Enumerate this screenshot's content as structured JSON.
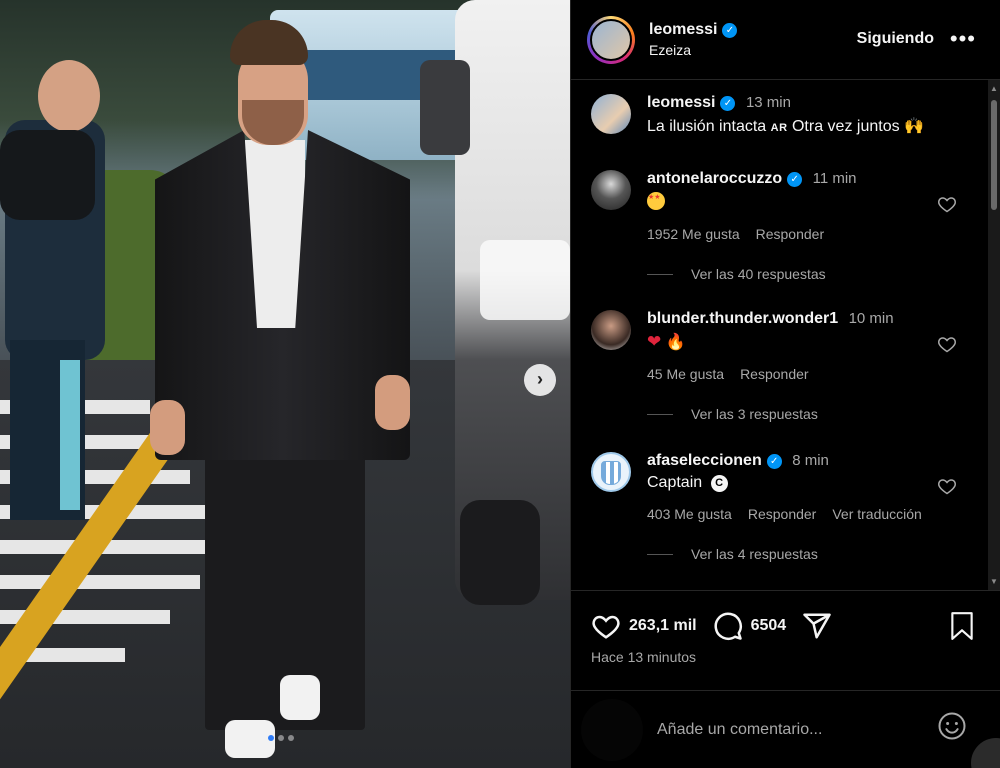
{
  "post": {
    "username": "leomessi",
    "location": "Ezeiza",
    "follow_label": "Siguiendo",
    "more_label": "•••",
    "caption_time": "13 min",
    "caption_text": "La ilusión intacta",
    "caption_flag": "AR",
    "caption_text2": "Otra vez juntos",
    "next_label": "›"
  },
  "comments": [
    {
      "username": "antonelaroccuzzo",
      "time": "11 min",
      "likes": "1952 Me gusta",
      "reply": "Responder",
      "replies": "Ver las 40 respuestas"
    },
    {
      "username": "blunder.thunder.wonder1",
      "time": "10 min",
      "likes": "45 Me gusta",
      "reply": "Responder",
      "replies": "Ver las 3 respuestas"
    },
    {
      "username": "afaseleccionen",
      "time": "8 min",
      "text": "Captain",
      "badge": "C",
      "likes": "403 Me gusta",
      "reply": "Responder",
      "translate": "Ver traducción",
      "replies": "Ver las 4 respuestas"
    }
  ],
  "actions": {
    "likes": "263,1 mil",
    "comments": "6504",
    "posted": "Hace 13 minutos"
  },
  "comment_box": {
    "placeholder": "Añade un comentario..."
  },
  "colors": {
    "verified": "#0095f6",
    "background": "#000000",
    "muted_text": "#a8a8a8"
  },
  "icons": [
    "heart-icon",
    "comment-icon",
    "share-icon",
    "bookmark-icon",
    "emoji-icon",
    "more-icon",
    "verified-icon",
    "chevron-right-icon"
  ]
}
